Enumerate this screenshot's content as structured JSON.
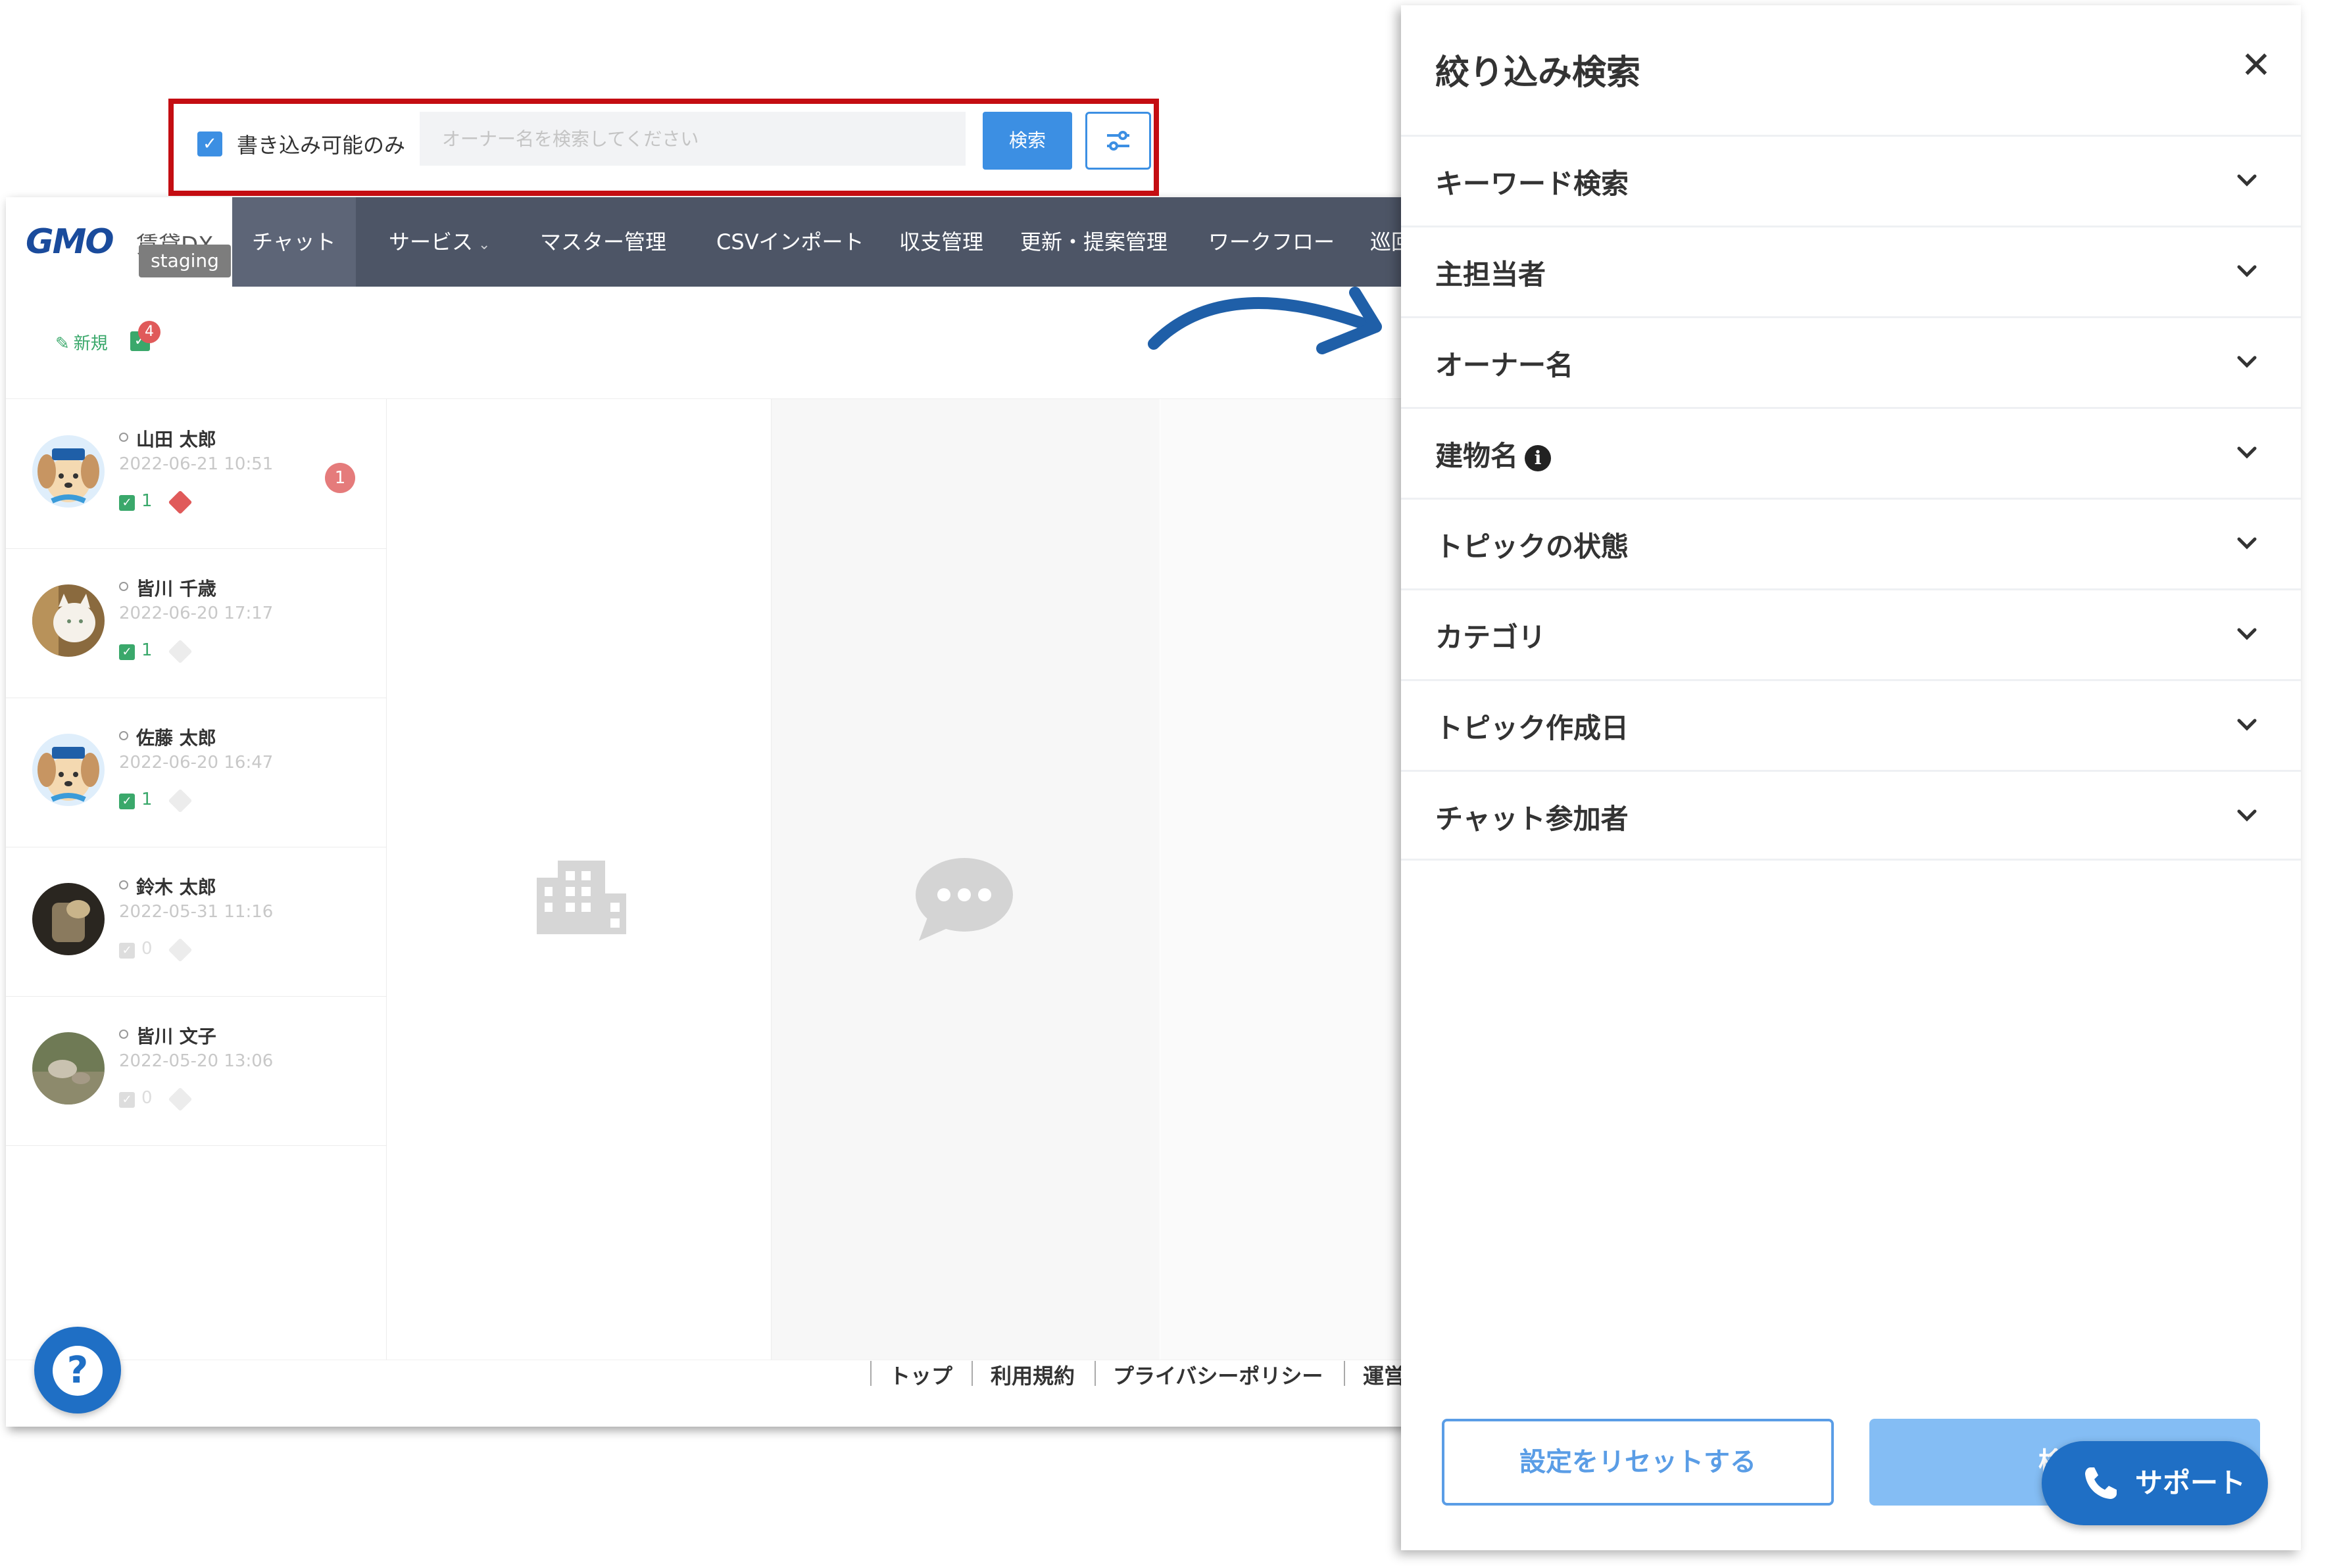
{
  "app": {
    "logo": {
      "brand": "GMO",
      "product": "賃貸DX",
      "env_badge": "staging"
    },
    "nav": [
      {
        "label": "チャット"
      },
      {
        "label": "サービス"
      },
      {
        "label": "マスター管理"
      },
      {
        "label": "CSVインポート"
      },
      {
        "label": "収支管理"
      },
      {
        "label": "更新・提案管理"
      },
      {
        "label": "ワークフロー"
      },
      {
        "label": "巡回"
      }
    ],
    "toolbar": {
      "new_label": "新規",
      "new_count": "4",
      "writable_only_label": "書き込み可能のみ",
      "owner_search_placeholder": "オーナー名を検索してください",
      "search_label": "検索"
    },
    "chats": [
      {
        "name": "山田 太郎",
        "date": "2022-06-21 10:51",
        "tasks": "1",
        "unread": "1"
      },
      {
        "name": "皆川 千歳",
        "date": "2022-06-20 17:17",
        "tasks": "1"
      },
      {
        "name": "佐藤 太郎",
        "date": "2022-06-20 16:47",
        "tasks": "1"
      },
      {
        "name": "鈴木 太郎",
        "date": "2022-05-31 11:16",
        "tasks": "0"
      },
      {
        "name": "皆川 文子",
        "date": "2022-05-20 13:06",
        "tasks": "0"
      }
    ],
    "footer": [
      "トップ",
      "利用規約",
      "プライバシーポリシー",
      "運営"
    ]
  },
  "drawer": {
    "title": "絞り込み検索",
    "sections": [
      {
        "label": "キーワード検索"
      },
      {
        "label": "主担当者"
      },
      {
        "label": "オーナー名"
      },
      {
        "label": "建物名"
      },
      {
        "label": "トピックの状態"
      },
      {
        "label": "カテゴリ"
      },
      {
        "label": "トピック作成日"
      },
      {
        "label": "チャット参加者"
      }
    ],
    "reset_label": "設定をリセットする",
    "search_label": "検索"
  },
  "support": {
    "label": "サポート"
  },
  "colors": {
    "nav": "#4d5566",
    "accent": "#3c8fe3",
    "highlight_border": "#c40d12",
    "arrow": "#1f5fa8"
  }
}
